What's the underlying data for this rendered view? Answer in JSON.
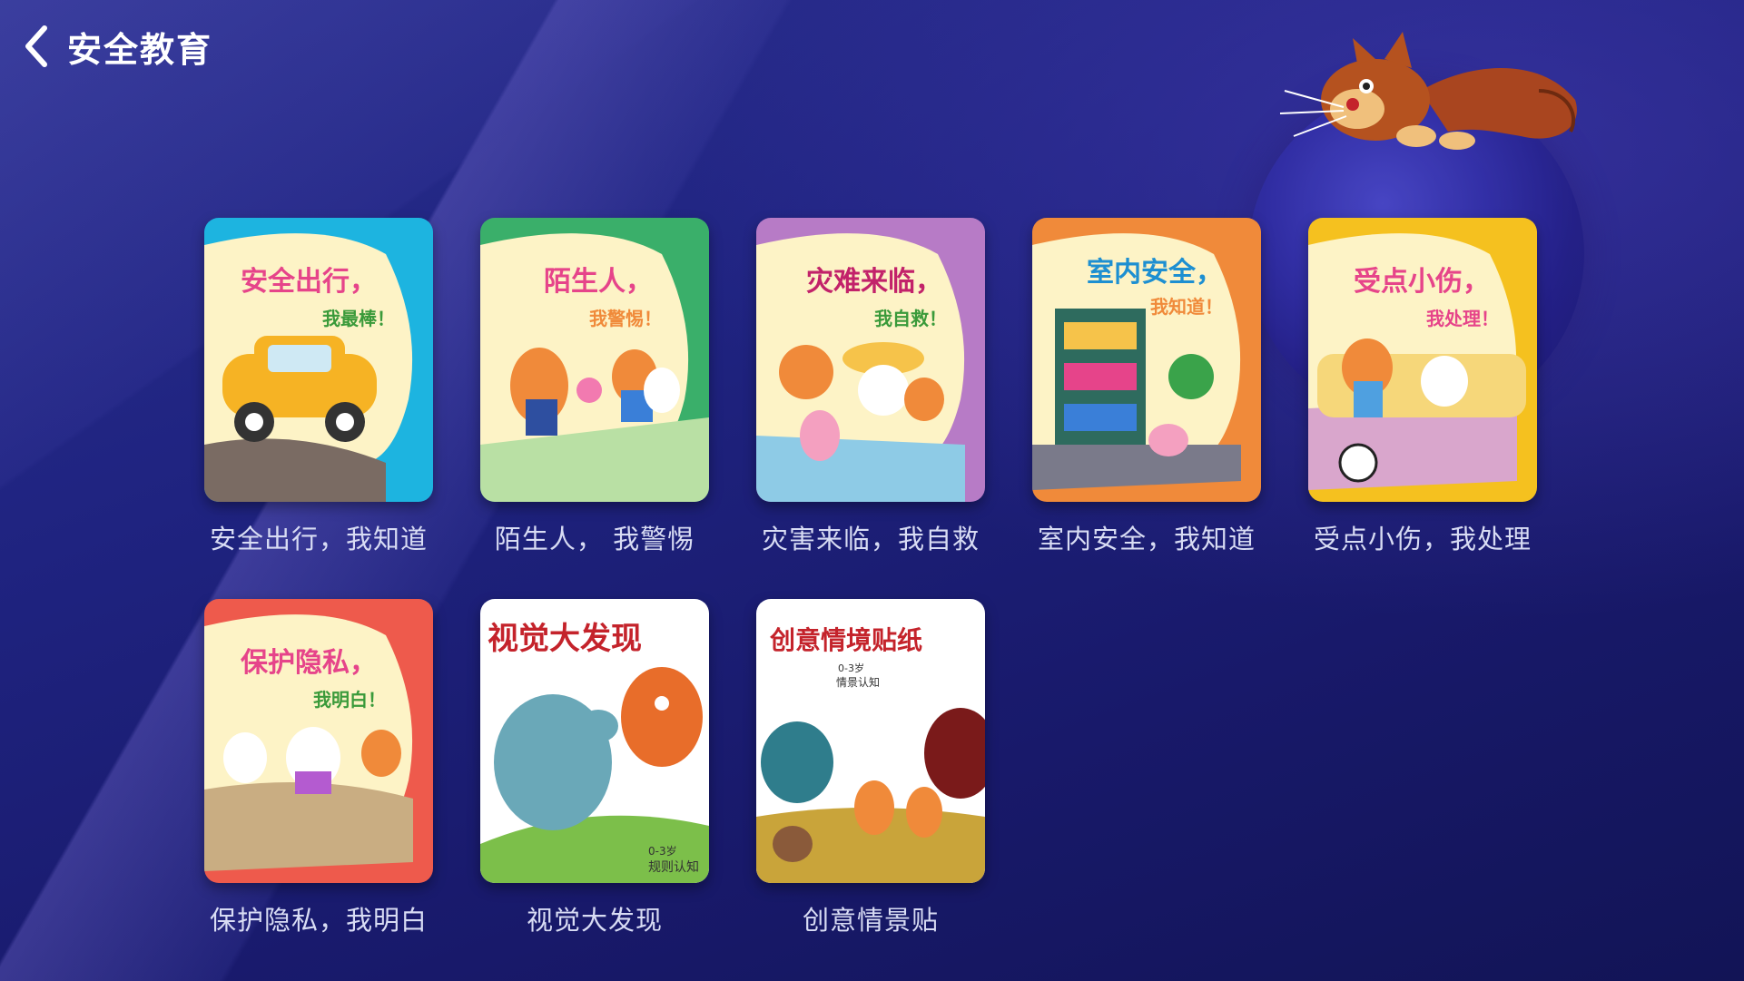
{
  "header": {
    "title": "安全教育"
  },
  "books": [
    {
      "label": "安全出行，我知道",
      "cover_title": "安全出行，",
      "cover_sub": "我最棒！",
      "color": "#1db4e0",
      "inner": "#fdf3c6"
    },
    {
      "label": "陌生人，  我警惕",
      "cover_title": "陌生人，",
      "cover_sub": "我警惕！",
      "color": "#3aaf6a",
      "inner": "#fdf3c6"
    },
    {
      "label": "灾害来临，我自救",
      "cover_title": "灾难来临，",
      "cover_sub": "我自救！",
      "color": "#b77bc6",
      "inner": "#fdf3c6"
    },
    {
      "label": "室内安全，我知道",
      "cover_title": "室内安全，",
      "cover_sub": "我知道！",
      "color": "#f08a3a",
      "inner": "#fdf3c6"
    },
    {
      "label": "受点小伤，我处理",
      "cover_title": "受点小伤，",
      "cover_sub": "我处理！",
      "color": "#f5c11f",
      "inner": "#fdf3c6"
    },
    {
      "label": "保护隐私，我明白",
      "cover_title": "保护隐私，",
      "cover_sub": "我明白！",
      "color": "#ee5a4c",
      "inner": "#fdf3c6"
    },
    {
      "label": "视觉大发现",
      "cover_title": "视觉大发现",
      "cover_sub": "规则认知",
      "cover_tag": "0-3岁",
      "color": "#ffffff",
      "inner": "#ffffff"
    },
    {
      "label": "创意情景贴",
      "cover_title": "创意情境贴纸",
      "cover_sub": "情景认知",
      "cover_tag": "0-3岁",
      "color": "#ffffff",
      "inner": "#ffffff"
    }
  ]
}
